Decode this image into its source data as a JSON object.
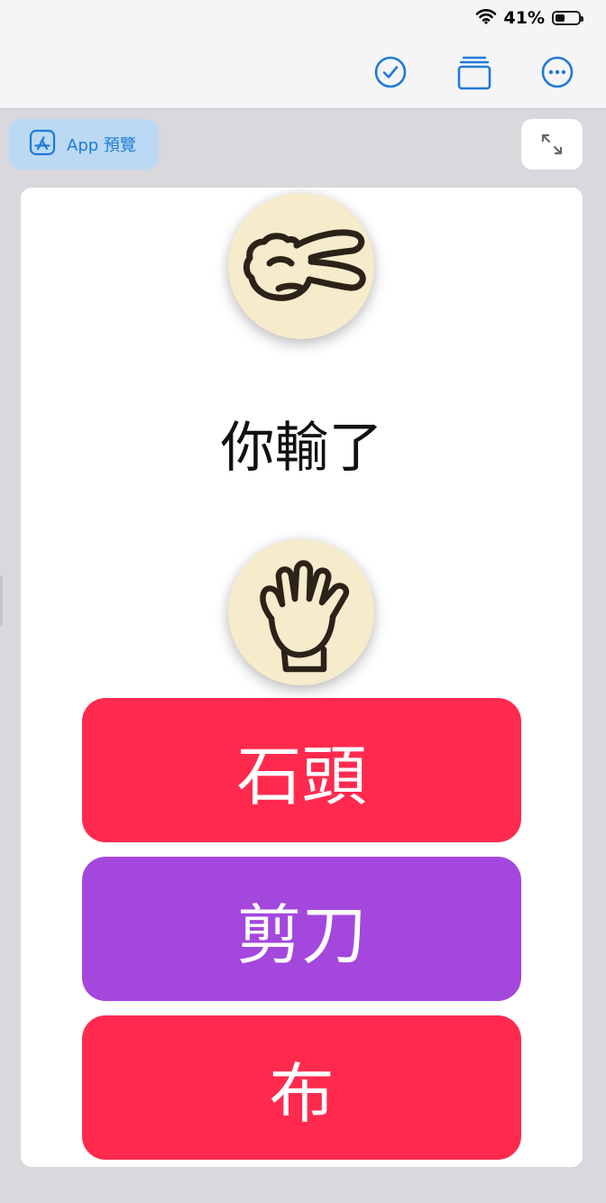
{
  "status": {
    "battery_percent": "41%",
    "battery_level": 0.41
  },
  "toolbar": {
    "icons": [
      "checkmark-circle-icon",
      "stacked-windows-icon",
      "more-ellipsis-icon"
    ]
  },
  "preview_button": {
    "label": "App 預覽",
    "icon": "app-store-icon"
  },
  "expand_button": {
    "icon": "expand-arrows-icon"
  },
  "game": {
    "opponent_hand": "scissors",
    "result_text": "你輸了",
    "player_hand": "paper",
    "choices": [
      {
        "label": "石頭",
        "color": "#ff2a4e"
      },
      {
        "label": "剪刀",
        "color": "#a447dd"
      },
      {
        "label": "布",
        "color": "#ff2a4e"
      }
    ]
  },
  "colors": {
    "accent": "#1f7ad8",
    "hand_bg": "#f6ebcb"
  }
}
